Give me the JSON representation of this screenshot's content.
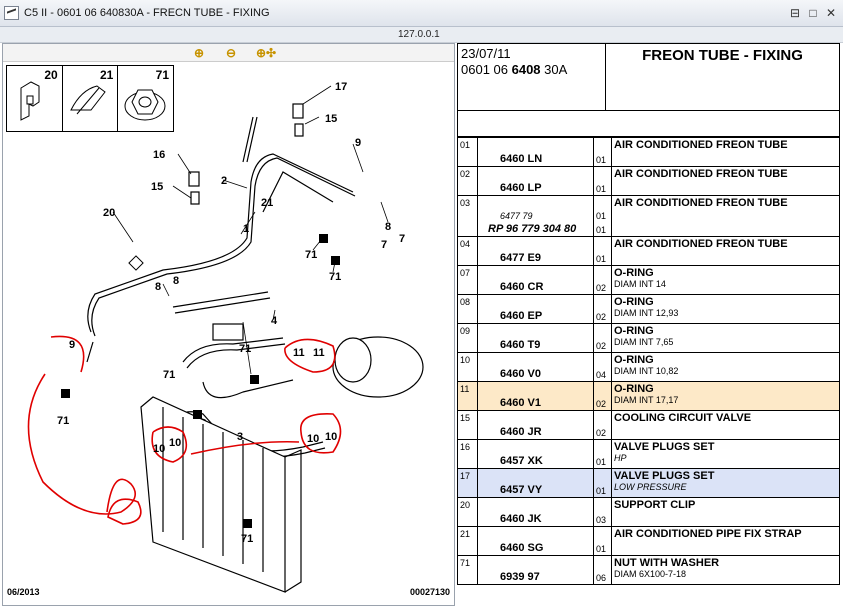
{
  "window": {
    "title": "C5 II - 0601 06 640830A - FRECN TUBE - FIXING",
    "address": "127.0.0.1",
    "buttons": [
      "⊟",
      "□",
      "✕"
    ]
  },
  "toolbar": {
    "zoom_in": "zoom-in-icon",
    "zoom_out": "zoom-out-icon",
    "zoom_fit": "zoom-fit-icon"
  },
  "legend": [
    {
      "num": "20"
    },
    {
      "num": "21"
    },
    {
      "num": "71"
    }
  ],
  "diagram": {
    "footer_left": "06/2013",
    "footer_right": "00027130",
    "labels": [
      {
        "t": "17"
      },
      {
        "t": "15"
      },
      {
        "t": "16"
      },
      {
        "t": "15"
      },
      {
        "t": "2"
      },
      {
        "t": "21"
      },
      {
        "t": "9"
      },
      {
        "t": "8"
      },
      {
        "t": "7"
      },
      {
        "t": "7"
      },
      {
        "t": "20"
      },
      {
        "t": "1"
      },
      {
        "t": "71"
      },
      {
        "t": "71"
      },
      {
        "t": "8"
      },
      {
        "t": "8"
      },
      {
        "t": "4"
      },
      {
        "t": "71"
      },
      {
        "t": "11"
      },
      {
        "t": "11"
      },
      {
        "t": "9"
      },
      {
        "t": "71"
      },
      {
        "t": "71"
      },
      {
        "t": "3"
      },
      {
        "t": "10"
      },
      {
        "t": "10"
      },
      {
        "t": "10"
      },
      {
        "t": "10"
      },
      {
        "t": "71"
      }
    ]
  },
  "header": {
    "date": "23/07/11",
    "code_prefix": "0601 06 ",
    "code_bold": "6408",
    "code_suffix": " 30A",
    "title": "FREON TUBE - FIXING"
  },
  "rows": [
    {
      "idx": "01",
      "ref": "6460 LN",
      "qty": "01",
      "desc": "AIR CONDITIONED FREON TUBE",
      "sub": "",
      "hl": ""
    },
    {
      "idx": "02",
      "ref": "6460 LP",
      "qty": "01",
      "desc": "AIR CONDITIONED FREON TUBE",
      "sub": "",
      "hl": ""
    },
    {
      "idx": "03",
      "ref": "RP 96 779 304 80",
      "alt": "6477 79",
      "qty": "01",
      "qty2": "01",
      "desc": "AIR CONDITIONED FREON TUBE",
      "sub": "",
      "hl": ""
    },
    {
      "idx": "04",
      "ref": "6477 E9",
      "qty": "01",
      "desc": "AIR CONDITIONED FREON TUBE",
      "sub": "",
      "hl": ""
    },
    {
      "idx": "07",
      "ref": "6460 CR",
      "qty": "02",
      "desc": "O-RING",
      "sub": "DIAM INT 14",
      "hl": ""
    },
    {
      "idx": "08",
      "ref": "6460 EP",
      "qty": "02",
      "desc": "O-RING",
      "sub": "DIAM INT 12,93",
      "hl": ""
    },
    {
      "idx": "09",
      "ref": "6460 T9",
      "qty": "02",
      "desc": "O-RING",
      "sub": "DIAM INT 7,65",
      "hl": ""
    },
    {
      "idx": "10",
      "ref": "6460 V0",
      "qty": "04",
      "desc": "O-RING",
      "sub": "DIAM INT 10,82",
      "hl": ""
    },
    {
      "idx": "11",
      "ref": "6460 V1",
      "qty": "02",
      "desc": "O-RING",
      "sub": "DIAM INT 17,17",
      "hl": "orange"
    },
    {
      "idx": "15",
      "ref": "6460 JR",
      "qty": "02",
      "desc": "COOLING CIRCUIT VALVE",
      "sub": "",
      "hl": ""
    },
    {
      "idx": "16",
      "ref": "6457 XK",
      "qty": "01",
      "desc": "VALVE PLUGS SET",
      "sub": "HP",
      "subit": true,
      "hl": ""
    },
    {
      "idx": "17",
      "ref": "6457 VY",
      "qty": "01",
      "desc": "VALVE PLUGS SET",
      "sub": "LOW PRESSURE",
      "subit": true,
      "hl": "blue"
    },
    {
      "idx": "20",
      "ref": "6460 JK",
      "qty": "03",
      "desc": "SUPPORT CLIP",
      "sub": "",
      "hl": ""
    },
    {
      "idx": "21",
      "ref": "6460 SG",
      "qty": "01",
      "desc": "AIR CONDITIONED PIPE FIX STRAP",
      "sub": "",
      "hl": ""
    },
    {
      "idx": "71",
      "ref": "6939 97",
      "qty": "06",
      "desc": "NUT WITH WASHER",
      "sub": "DIAM 6X100-7-18",
      "hl": ""
    }
  ],
  "colors": {
    "highlight_orange": "#fde9c8",
    "highlight_blue": "#dbe3f7",
    "annotation_red": "#e00000"
  }
}
